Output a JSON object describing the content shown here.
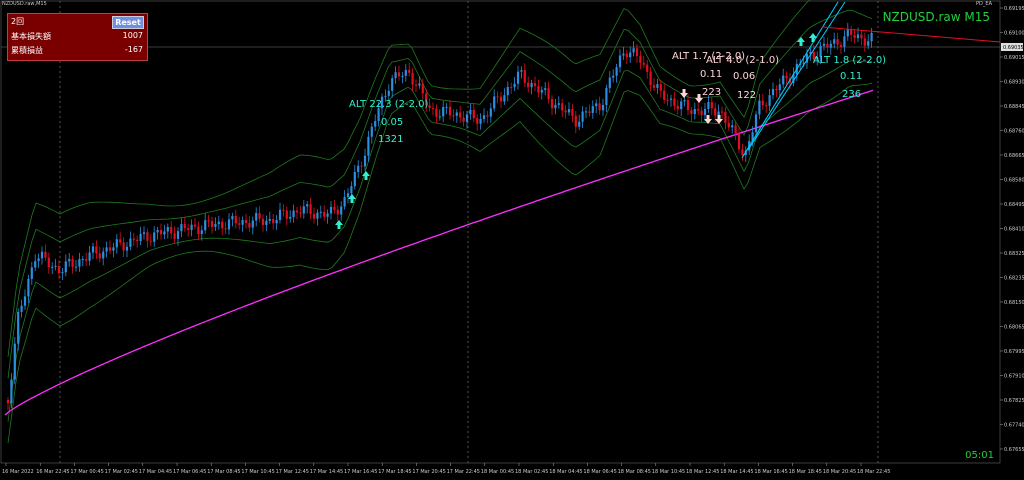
{
  "window": {
    "title": "NZDUSD.raw,M15",
    "ea_label": "PD_EA",
    "symbol": "NZDUSD.raw M15",
    "timer": "05:01"
  },
  "panel": {
    "count_label": "2回",
    "reset_label": "Reset",
    "rows": [
      {
        "label": "基本損失額",
        "value": "1007"
      },
      {
        "label": "累積損益",
        "value": "-167"
      }
    ]
  },
  "colors": {
    "up": "#2a8fe0",
    "down": "#e01020",
    "ma": "#ff30ff",
    "bands": "#1f7a1f",
    "signal_up": "#30f0d0",
    "signal_down": "#ffd6d6",
    "trend": "#00d0ff",
    "resistance": "#e01020"
  },
  "price_axis": {
    "labels": [
      "0.69195",
      "0.69100",
      "0.69015",
      "0.68930",
      "0.68845",
      "0.68760",
      "0.68665",
      "0.68580",
      "0.68495",
      "0.68410",
      "0.68325",
      "0.68235",
      "0.68150",
      "0.68065",
      "0.67995",
      "0.67910",
      "0.67825",
      "0.67740",
      "0.67655"
    ],
    "current_price": "0.69035"
  },
  "time_axis": {
    "labels": [
      "16 Mar 2022",
      "16 Mar 22:45",
      "17 Mar 00:45",
      "17 Mar 02:45",
      "17 Mar 04:45",
      "17 Mar 06:45",
      "17 Mar 08:45",
      "17 Mar 10:45",
      "17 Mar 12:45",
      "17 Mar 14:45",
      "17 Mar 16:45",
      "17 Mar 18:45",
      "17 Mar 20:45",
      "17 Mar 22:45",
      "18 Mar 00:45",
      "18 Mar 02:45",
      "18 Mar 04:45",
      "18 Mar 06:45",
      "18 Mar 08:45",
      "18 Mar 10:45",
      "18 Mar 12:45",
      "18 Mar 14:45",
      "18 Mar 16:45",
      "18 Mar 18:45",
      "18 Mar 20:45",
      "18 Mar 22:45"
    ]
  },
  "annotations": [
    {
      "text": "ALT 22.3 (2-2.0)",
      "color": "cyan"
    },
    {
      "text": "0.05",
      "color": "cyan"
    },
    {
      "text": "1321",
      "color": "cyan"
    },
    {
      "text": "ALT 1.7 (2-2.0)",
      "color": "pink"
    },
    {
      "text": "0.11",
      "color": "pink"
    },
    {
      "text": "ALT 4.0 (2-1.0)",
      "color": "pink"
    },
    {
      "text": "0.06",
      "color": "pink"
    },
    {
      "text": "223",
      "color": "pink"
    },
    {
      "text": "122",
      "color": "pink"
    },
    {
      "text": "ALT 1.8 (2-2.0)",
      "color": "cyan"
    },
    {
      "text": "0.11",
      "color": "cyan"
    },
    {
      "text": "236",
      "color": "cyan"
    }
  ]
}
